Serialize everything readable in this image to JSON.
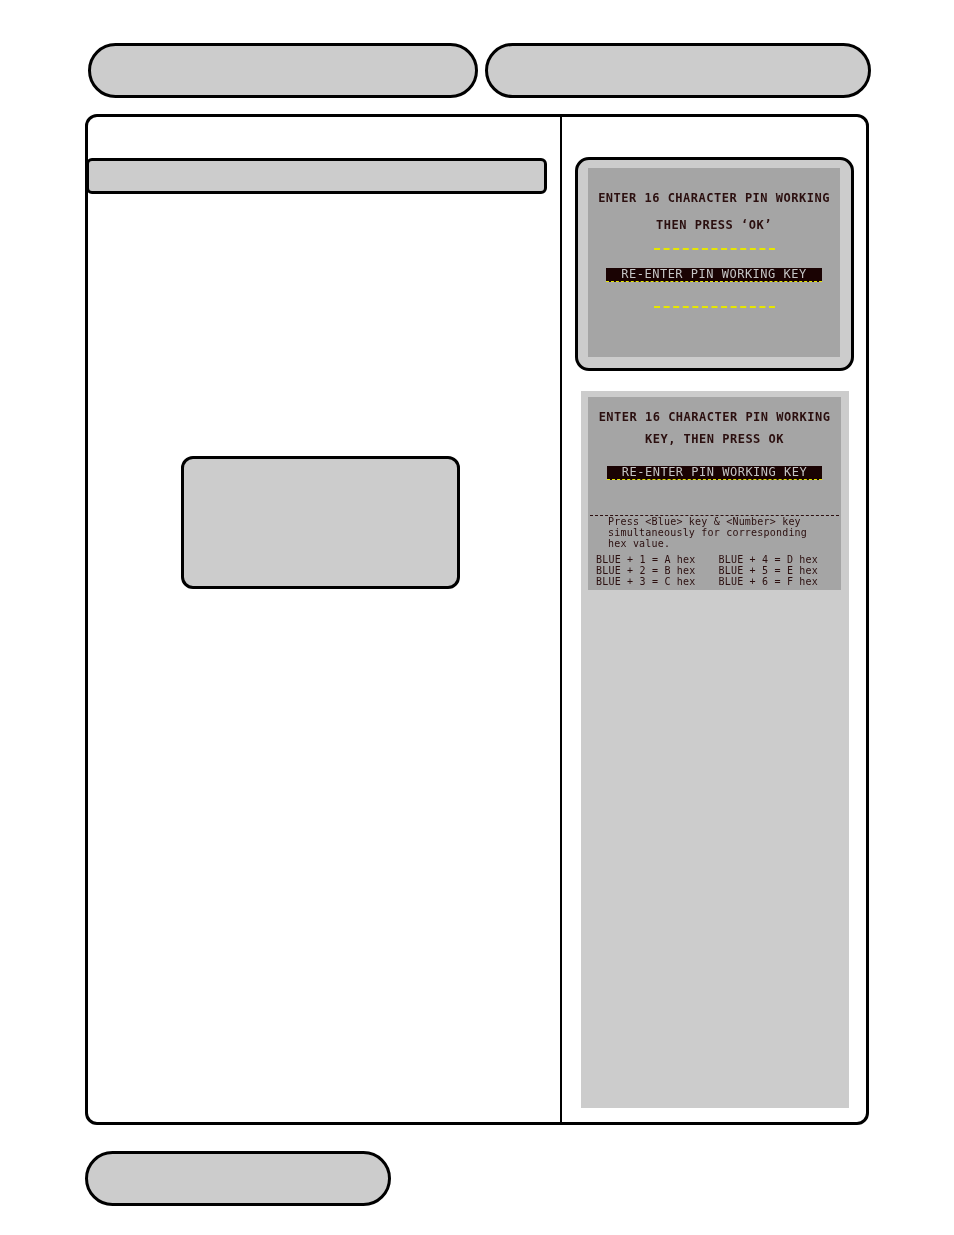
{
  "screens": [
    {
      "kind": "framed",
      "prompt_lines": [
        "ENTER 16 CHARACTER PIN WORKING",
        "THEN PRESS ‘OK’"
      ],
      "highlight": "RE-ENTER PIN WORKING KEY"
    },
    {
      "kind": "panel",
      "prompt_lines": [
        "ENTER 16 CHARACTER PIN WORKING",
        "KEY, THEN PRESS OK"
      ],
      "highlight": "RE-ENTER PIN WORKING KEY",
      "instructions": [
        "Press <Blue> key & <Number> key",
        "simultaneously for corresponding",
        "hex value."
      ],
      "hex_keys": [
        [
          "BLUE + 1 = A hex",
          "BLUE + 2 = B hex",
          "BLUE + 3 = C hex"
        ],
        [
          "BLUE + 4 = D hex",
          "BLUE + 5 = E hex",
          "BLUE + 6 = F hex"
        ]
      ]
    }
  ]
}
